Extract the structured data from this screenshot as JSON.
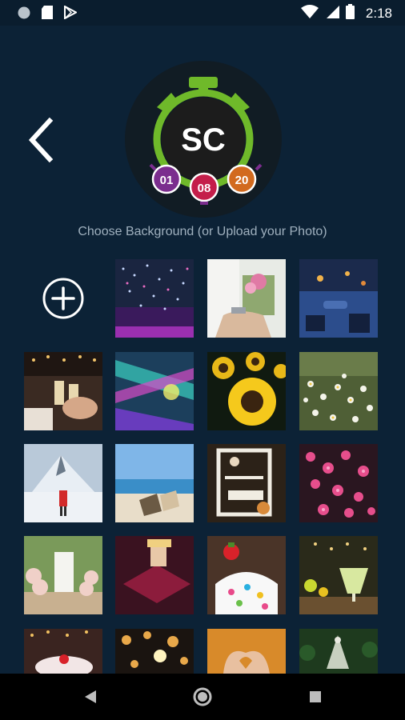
{
  "status_bar": {
    "time": "2:18",
    "left_icons": [
      "circle-notification-icon",
      "sd-card-icon",
      "play-store-icon"
    ],
    "right_icons": [
      "wifi-icon",
      "signal-icon",
      "battery-icon"
    ]
  },
  "header": {
    "logo": {
      "letters": "SC",
      "counters": [
        "01",
        "08",
        "20"
      ],
      "colors": {
        "green": "#6fb92a",
        "purple": "#7b2d8e",
        "red": "#c41e4a",
        "orange": "#d26a1e",
        "dark": "#1c1c1c"
      }
    }
  },
  "subtitle": "Choose Background (or Upload your Photo)",
  "add_button": {
    "icon": "plus-circle-icon"
  },
  "backgrounds": [
    {
      "name": "confetti-concert"
    },
    {
      "name": "wedding-hands-bouquet"
    },
    {
      "name": "dinner-party-table"
    },
    {
      "name": "champagne-toast"
    },
    {
      "name": "neon-party-lights"
    },
    {
      "name": "sunflowers"
    },
    {
      "name": "daisy-field"
    },
    {
      "name": "snowy-mountain-hiker"
    },
    {
      "name": "beach-chairs"
    },
    {
      "name": "wedding-welcome-sign"
    },
    {
      "name": "pink-blossoms"
    },
    {
      "name": "wedding-aisle-flowers"
    },
    {
      "name": "graduation-cap"
    },
    {
      "name": "birthday-cupcake"
    },
    {
      "name": "margarita-drinks"
    },
    {
      "name": "celebration-cake"
    },
    {
      "name": "sparkler-bokeh"
    },
    {
      "name": "heart-hands"
    },
    {
      "name": "christmas-tree-forest"
    }
  ],
  "nav_bar": {
    "buttons": [
      "back-triangle-icon",
      "home-circle-icon",
      "recents-square-icon"
    ]
  }
}
